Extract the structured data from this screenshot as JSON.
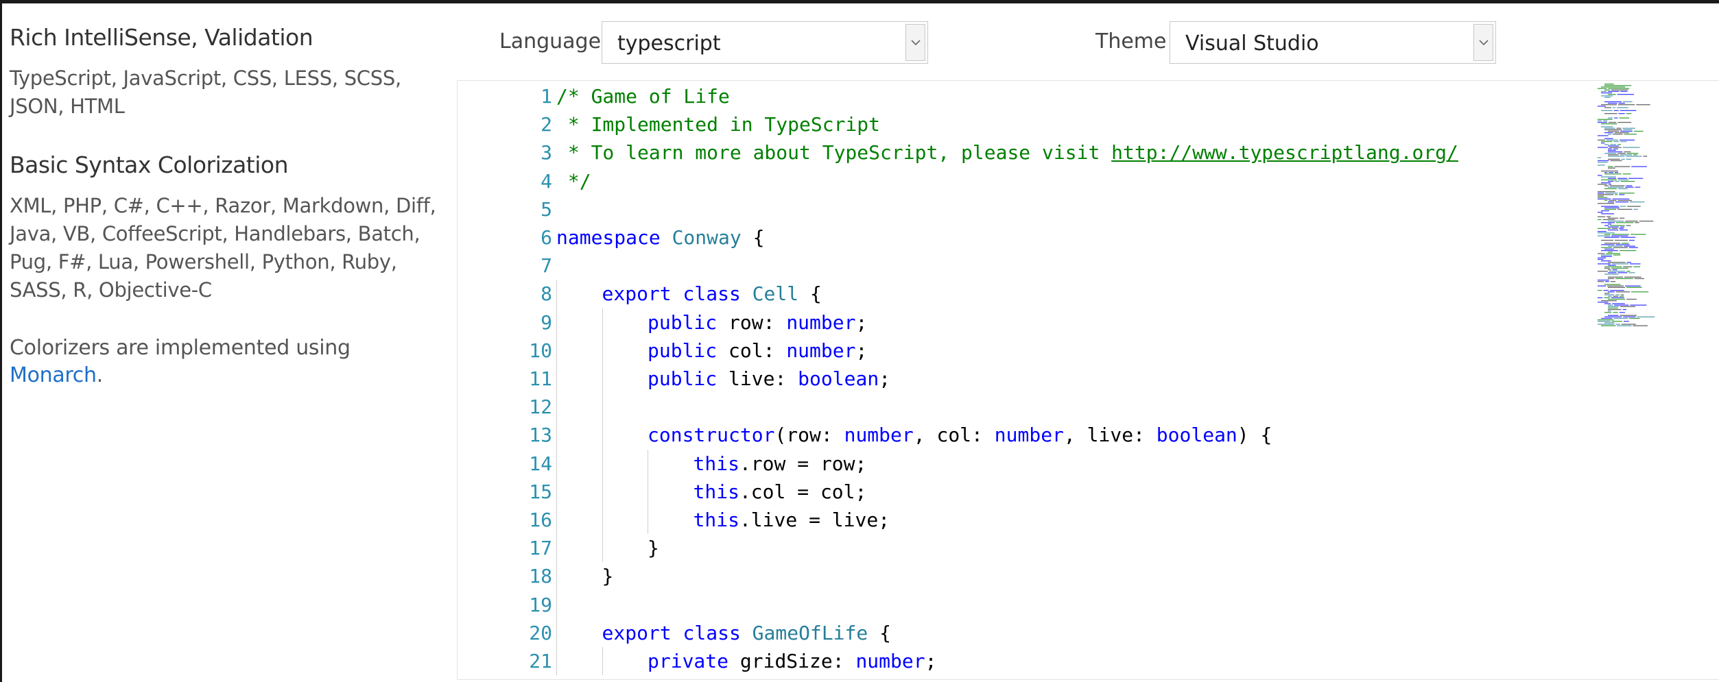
{
  "sidebar": {
    "sections": [
      {
        "title": "Rich IntelliSense, Validation",
        "lines": [
          "TypeScript, JavaScript, CSS, LESS, SCSS,",
          "JSON, HTML"
        ]
      },
      {
        "title": "Basic Syntax Colorization",
        "lines": [
          "XML, PHP, C#, C++, Razor, Markdown, Diff,",
          "Java, VB, CoffeeScript, Handlebars, Batch,",
          "Pug, F#, Lua, Powershell, Python, Ruby,",
          "SASS, R, Objective-C"
        ]
      }
    ],
    "note": {
      "text": "Colorizers are implemented using ",
      "link": "Monarch",
      "end": "."
    }
  },
  "toolbar": {
    "language_label": "Language",
    "language_value": "typescript",
    "theme_label": "Theme",
    "theme_value": "Visual Studio"
  },
  "editor": {
    "lines": [
      {
        "n": "1",
        "indent": 0,
        "tokens": [
          {
            "t": "/* Game of Life",
            "c": "com"
          }
        ]
      },
      {
        "n": "2",
        "indent": 0,
        "tokens": [
          {
            "t": " * Implemented in TypeScript",
            "c": "com"
          }
        ]
      },
      {
        "n": "3",
        "indent": 0,
        "tokens": [
          {
            "t": " * To learn more about TypeScript, please visit ",
            "c": "com"
          },
          {
            "t": "http://www.typescriptlang.org/",
            "c": "link"
          }
        ]
      },
      {
        "n": "4",
        "indent": 0,
        "tokens": [
          {
            "t": " */",
            "c": "com"
          }
        ]
      },
      {
        "n": "5",
        "indent": 0,
        "tokens": []
      },
      {
        "n": "6",
        "indent": 0,
        "tokens": [
          {
            "t": "namespace",
            "c": "kw"
          },
          {
            "t": " "
          },
          {
            "t": "Conway",
            "c": "type"
          },
          {
            "t": " {"
          }
        ]
      },
      {
        "n": "7",
        "indent": 0,
        "tokens": []
      },
      {
        "n": "8",
        "indent": 1,
        "tokens": [
          {
            "t": "export",
            "c": "kw"
          },
          {
            "t": " "
          },
          {
            "t": "class",
            "c": "kw"
          },
          {
            "t": " "
          },
          {
            "t": "Cell",
            "c": "type"
          },
          {
            "t": " {"
          }
        ]
      },
      {
        "n": "9",
        "indent": 2,
        "tokens": [
          {
            "t": "public",
            "c": "kw"
          },
          {
            "t": " row: "
          },
          {
            "t": "number",
            "c": "kw"
          },
          {
            "t": ";"
          }
        ]
      },
      {
        "n": "10",
        "indent": 2,
        "tokens": [
          {
            "t": "public",
            "c": "kw"
          },
          {
            "t": " col: "
          },
          {
            "t": "number",
            "c": "kw"
          },
          {
            "t": ";"
          }
        ]
      },
      {
        "n": "11",
        "indent": 2,
        "tokens": [
          {
            "t": "public",
            "c": "kw"
          },
          {
            "t": " live: "
          },
          {
            "t": "boolean",
            "c": "kw"
          },
          {
            "t": ";"
          }
        ]
      },
      {
        "n": "12",
        "indent": 2,
        "tokens": []
      },
      {
        "n": "13",
        "indent": 2,
        "tokens": [
          {
            "t": "constructor",
            "c": "kw"
          },
          {
            "t": "(row: "
          },
          {
            "t": "number",
            "c": "kw"
          },
          {
            "t": ", col: "
          },
          {
            "t": "number",
            "c": "kw"
          },
          {
            "t": ", live: "
          },
          {
            "t": "boolean",
            "c": "kw"
          },
          {
            "t": ") {"
          }
        ]
      },
      {
        "n": "14",
        "indent": 3,
        "tokens": [
          {
            "t": "this",
            "c": "kw"
          },
          {
            "t": ".row = row;"
          }
        ]
      },
      {
        "n": "15",
        "indent": 3,
        "tokens": [
          {
            "t": "this",
            "c": "kw"
          },
          {
            "t": ".col = col;"
          }
        ]
      },
      {
        "n": "16",
        "indent": 3,
        "tokens": [
          {
            "t": "this",
            "c": "kw"
          },
          {
            "t": ".live = live;"
          }
        ]
      },
      {
        "n": "17",
        "indent": 2,
        "tokens": [
          {
            "t": "}"
          }
        ]
      },
      {
        "n": "18",
        "indent": 1,
        "tokens": [
          {
            "t": "}"
          }
        ]
      },
      {
        "n": "19",
        "indent": 1,
        "tokens": []
      },
      {
        "n": "20",
        "indent": 1,
        "tokens": [
          {
            "t": "export",
            "c": "kw"
          },
          {
            "t": " "
          },
          {
            "t": "class",
            "c": "kw"
          },
          {
            "t": " "
          },
          {
            "t": "GameOfLife",
            "c": "type"
          },
          {
            "t": " {"
          }
        ]
      },
      {
        "n": "21",
        "indent": 2,
        "tokens": [
          {
            "t": "private",
            "c": "kw"
          },
          {
            "t": " gridSize: "
          },
          {
            "t": "number",
            "c": "kw"
          },
          {
            "t": ";"
          }
        ]
      }
    ]
  },
  "colors": {
    "comment": "#008000",
    "keyword": "#0000ff",
    "type": "#267f99",
    "line_number": "#2b91af",
    "link": "#1e6fc8"
  }
}
